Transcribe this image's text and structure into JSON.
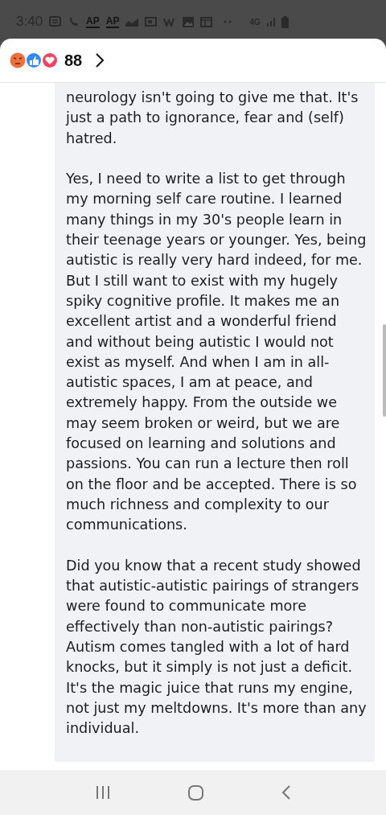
{
  "status_bar": {
    "time": "3:40",
    "notification_texts": [
      "AP",
      "AP"
    ],
    "network": "4G"
  },
  "header": {
    "reaction_count": "88"
  },
  "comment": {
    "paragraphs": [
      "neurology isn't going to give me that. It's just a path to ignorance, fear and (self) hatred.",
      "Yes, I need to write a list to get through my morning self care routine. I learned many things in my 30's people learn in their teenage years or younger. Yes, being autistic is really very hard indeed, for me. But I still want to exist with my hugely spiky cognitive profile. It makes me an excellent artist and a wonderful friend and without being autistic I would not exist as myself. And when I am in all-autistic spaces, I am at peace, and extremely happy. From the outside we may seem broken or weird, but we are focused on learning and solutions and passions. You can run a lecture then roll on the floor and be accepted. There is so much richness and complexity to our communications.",
      "Did you know that a recent study showed that autistic-autistic pairings of strangers were found to communicate more effectively than non-autistic pairings? Autism comes tangled with a lot of hard knocks, but it simply is not just a deficit. It's the magic juice that runs my engine, not just my meltdowns. It's more than any individual."
    ]
  }
}
